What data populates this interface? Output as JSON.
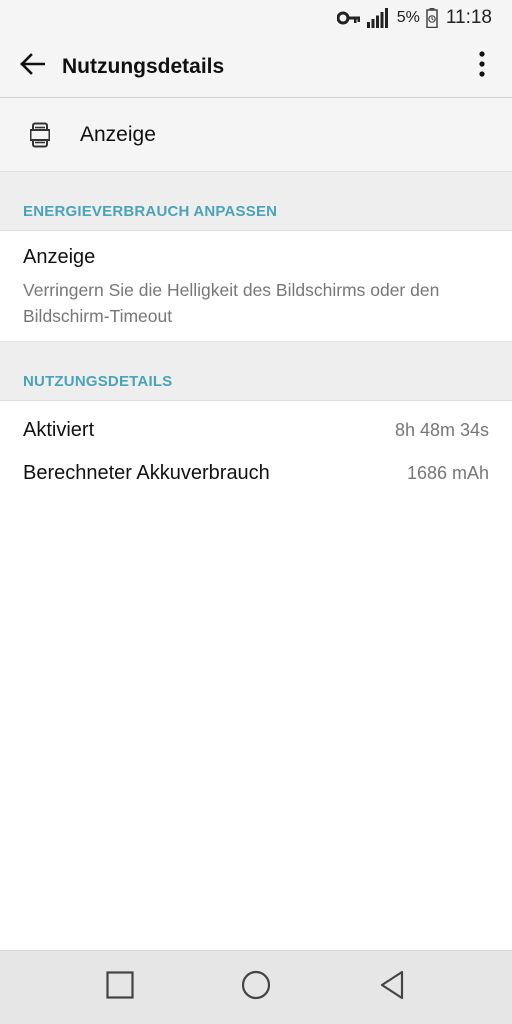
{
  "status_bar": {
    "battery_percent": "5%",
    "time": "11:18",
    "icons": [
      "vpn-key-icon",
      "signal-icon",
      "battery-charging-icon"
    ]
  },
  "toolbar": {
    "back_icon": "arrow-back-icon",
    "title": "Nutzungsdetails",
    "overflow_icon": "more-vert-icon"
  },
  "app": {
    "icon": "display-icon",
    "name": "Anzeige"
  },
  "sections": {
    "adjust": {
      "header": "ENERGIEVERBRAUCH ANPASSEN",
      "item_title": "Anzeige",
      "item_summary": "Verringern Sie die Helligkeit des Bildschirms oder den Bildschirm-Timeout"
    },
    "usage": {
      "header": "NUTZUNGSDETAILS",
      "rows": [
        {
          "label": "Aktiviert",
          "value": "8h 48m 34s"
        },
        {
          "label": "Berechneter Akkuverbrauch",
          "value": "1686 mAh"
        }
      ]
    }
  },
  "navbar": {
    "recents_icon": "square-recents-icon",
    "home_icon": "circle-home-icon",
    "back_icon": "triangle-back-icon"
  },
  "colors": {
    "section_header": "#4aa3b8",
    "background": "#ffffff",
    "header_bg": "#f5f5f5"
  }
}
